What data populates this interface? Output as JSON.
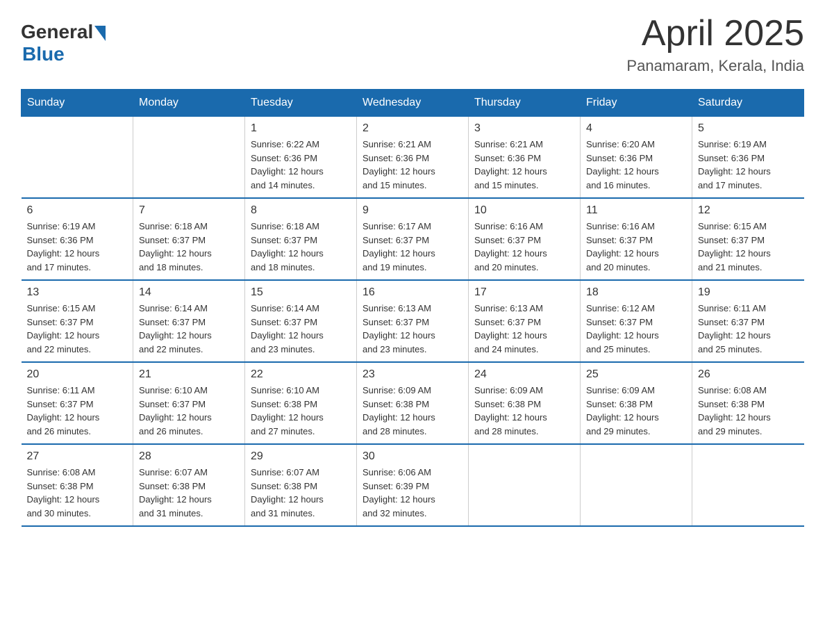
{
  "logo": {
    "general": "General",
    "blue": "Blue"
  },
  "header": {
    "title": "April 2025",
    "location": "Panamaram, Kerala, India"
  },
  "days_of_week": [
    "Sunday",
    "Monday",
    "Tuesday",
    "Wednesday",
    "Thursday",
    "Friday",
    "Saturday"
  ],
  "weeks": [
    [
      {
        "day": "",
        "info": ""
      },
      {
        "day": "",
        "info": ""
      },
      {
        "day": "1",
        "info": "Sunrise: 6:22 AM\nSunset: 6:36 PM\nDaylight: 12 hours\nand 14 minutes."
      },
      {
        "day": "2",
        "info": "Sunrise: 6:21 AM\nSunset: 6:36 PM\nDaylight: 12 hours\nand 15 minutes."
      },
      {
        "day": "3",
        "info": "Sunrise: 6:21 AM\nSunset: 6:36 PM\nDaylight: 12 hours\nand 15 minutes."
      },
      {
        "day": "4",
        "info": "Sunrise: 6:20 AM\nSunset: 6:36 PM\nDaylight: 12 hours\nand 16 minutes."
      },
      {
        "day": "5",
        "info": "Sunrise: 6:19 AM\nSunset: 6:36 PM\nDaylight: 12 hours\nand 17 minutes."
      }
    ],
    [
      {
        "day": "6",
        "info": "Sunrise: 6:19 AM\nSunset: 6:36 PM\nDaylight: 12 hours\nand 17 minutes."
      },
      {
        "day": "7",
        "info": "Sunrise: 6:18 AM\nSunset: 6:37 PM\nDaylight: 12 hours\nand 18 minutes."
      },
      {
        "day": "8",
        "info": "Sunrise: 6:18 AM\nSunset: 6:37 PM\nDaylight: 12 hours\nand 18 minutes."
      },
      {
        "day": "9",
        "info": "Sunrise: 6:17 AM\nSunset: 6:37 PM\nDaylight: 12 hours\nand 19 minutes."
      },
      {
        "day": "10",
        "info": "Sunrise: 6:16 AM\nSunset: 6:37 PM\nDaylight: 12 hours\nand 20 minutes."
      },
      {
        "day": "11",
        "info": "Sunrise: 6:16 AM\nSunset: 6:37 PM\nDaylight: 12 hours\nand 20 minutes."
      },
      {
        "day": "12",
        "info": "Sunrise: 6:15 AM\nSunset: 6:37 PM\nDaylight: 12 hours\nand 21 minutes."
      }
    ],
    [
      {
        "day": "13",
        "info": "Sunrise: 6:15 AM\nSunset: 6:37 PM\nDaylight: 12 hours\nand 22 minutes."
      },
      {
        "day": "14",
        "info": "Sunrise: 6:14 AM\nSunset: 6:37 PM\nDaylight: 12 hours\nand 22 minutes."
      },
      {
        "day": "15",
        "info": "Sunrise: 6:14 AM\nSunset: 6:37 PM\nDaylight: 12 hours\nand 23 minutes."
      },
      {
        "day": "16",
        "info": "Sunrise: 6:13 AM\nSunset: 6:37 PM\nDaylight: 12 hours\nand 23 minutes."
      },
      {
        "day": "17",
        "info": "Sunrise: 6:13 AM\nSunset: 6:37 PM\nDaylight: 12 hours\nand 24 minutes."
      },
      {
        "day": "18",
        "info": "Sunrise: 6:12 AM\nSunset: 6:37 PM\nDaylight: 12 hours\nand 25 minutes."
      },
      {
        "day": "19",
        "info": "Sunrise: 6:11 AM\nSunset: 6:37 PM\nDaylight: 12 hours\nand 25 minutes."
      }
    ],
    [
      {
        "day": "20",
        "info": "Sunrise: 6:11 AM\nSunset: 6:37 PM\nDaylight: 12 hours\nand 26 minutes."
      },
      {
        "day": "21",
        "info": "Sunrise: 6:10 AM\nSunset: 6:37 PM\nDaylight: 12 hours\nand 26 minutes."
      },
      {
        "day": "22",
        "info": "Sunrise: 6:10 AM\nSunset: 6:38 PM\nDaylight: 12 hours\nand 27 minutes."
      },
      {
        "day": "23",
        "info": "Sunrise: 6:09 AM\nSunset: 6:38 PM\nDaylight: 12 hours\nand 28 minutes."
      },
      {
        "day": "24",
        "info": "Sunrise: 6:09 AM\nSunset: 6:38 PM\nDaylight: 12 hours\nand 28 minutes."
      },
      {
        "day": "25",
        "info": "Sunrise: 6:09 AM\nSunset: 6:38 PM\nDaylight: 12 hours\nand 29 minutes."
      },
      {
        "day": "26",
        "info": "Sunrise: 6:08 AM\nSunset: 6:38 PM\nDaylight: 12 hours\nand 29 minutes."
      }
    ],
    [
      {
        "day": "27",
        "info": "Sunrise: 6:08 AM\nSunset: 6:38 PM\nDaylight: 12 hours\nand 30 minutes."
      },
      {
        "day": "28",
        "info": "Sunrise: 6:07 AM\nSunset: 6:38 PM\nDaylight: 12 hours\nand 31 minutes."
      },
      {
        "day": "29",
        "info": "Sunrise: 6:07 AM\nSunset: 6:38 PM\nDaylight: 12 hours\nand 31 minutes."
      },
      {
        "day": "30",
        "info": "Sunrise: 6:06 AM\nSunset: 6:39 PM\nDaylight: 12 hours\nand 32 minutes."
      },
      {
        "day": "",
        "info": ""
      },
      {
        "day": "",
        "info": ""
      },
      {
        "day": "",
        "info": ""
      }
    ]
  ]
}
